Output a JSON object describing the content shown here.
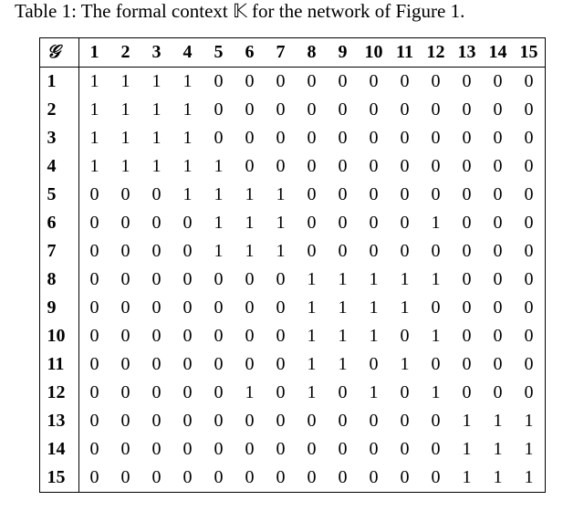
{
  "caption_prefix": "Table 1: The formal context ",
  "caption_symbol": "𝕂",
  "caption_suffix": " for the network of Figure 1.",
  "corner_symbol": "𝒢",
  "col_labels": [
    "1",
    "2",
    "3",
    "4",
    "5",
    "6",
    "7",
    "8",
    "9",
    "10",
    "11",
    "12",
    "13",
    "14",
    "15"
  ],
  "row_labels": [
    "1",
    "2",
    "3",
    "4",
    "5",
    "6",
    "7",
    "8",
    "9",
    "10",
    "11",
    "12",
    "13",
    "14",
    "15"
  ],
  "chart_data": {
    "type": "table",
    "title": "Formal context 𝕂",
    "matrix": [
      [
        1,
        1,
        1,
        1,
        0,
        0,
        0,
        0,
        0,
        0,
        0,
        0,
        0,
        0,
        0
      ],
      [
        1,
        1,
        1,
        1,
        0,
        0,
        0,
        0,
        0,
        0,
        0,
        0,
        0,
        0,
        0
      ],
      [
        1,
        1,
        1,
        1,
        0,
        0,
        0,
        0,
        0,
        0,
        0,
        0,
        0,
        0,
        0
      ],
      [
        1,
        1,
        1,
        1,
        1,
        0,
        0,
        0,
        0,
        0,
        0,
        0,
        0,
        0,
        0
      ],
      [
        0,
        0,
        0,
        1,
        1,
        1,
        1,
        0,
        0,
        0,
        0,
        0,
        0,
        0,
        0
      ],
      [
        0,
        0,
        0,
        0,
        1,
        1,
        1,
        0,
        0,
        0,
        0,
        1,
        0,
        0,
        0
      ],
      [
        0,
        0,
        0,
        0,
        1,
        1,
        1,
        0,
        0,
        0,
        0,
        0,
        0,
        0,
        0
      ],
      [
        0,
        0,
        0,
        0,
        0,
        0,
        0,
        1,
        1,
        1,
        1,
        1,
        0,
        0,
        0
      ],
      [
        0,
        0,
        0,
        0,
        0,
        0,
        0,
        1,
        1,
        1,
        1,
        0,
        0,
        0,
        0
      ],
      [
        0,
        0,
        0,
        0,
        0,
        0,
        0,
        1,
        1,
        1,
        0,
        1,
        0,
        0,
        0
      ],
      [
        0,
        0,
        0,
        0,
        0,
        0,
        0,
        1,
        1,
        0,
        1,
        0,
        0,
        0,
        0
      ],
      [
        0,
        0,
        0,
        0,
        0,
        1,
        0,
        1,
        0,
        1,
        0,
        1,
        0,
        0,
        0
      ],
      [
        0,
        0,
        0,
        0,
        0,
        0,
        0,
        0,
        0,
        0,
        0,
        0,
        1,
        1,
        1
      ],
      [
        0,
        0,
        0,
        0,
        0,
        0,
        0,
        0,
        0,
        0,
        0,
        0,
        1,
        1,
        1
      ],
      [
        0,
        0,
        0,
        0,
        0,
        0,
        0,
        0,
        0,
        0,
        0,
        0,
        1,
        1,
        1
      ]
    ]
  }
}
